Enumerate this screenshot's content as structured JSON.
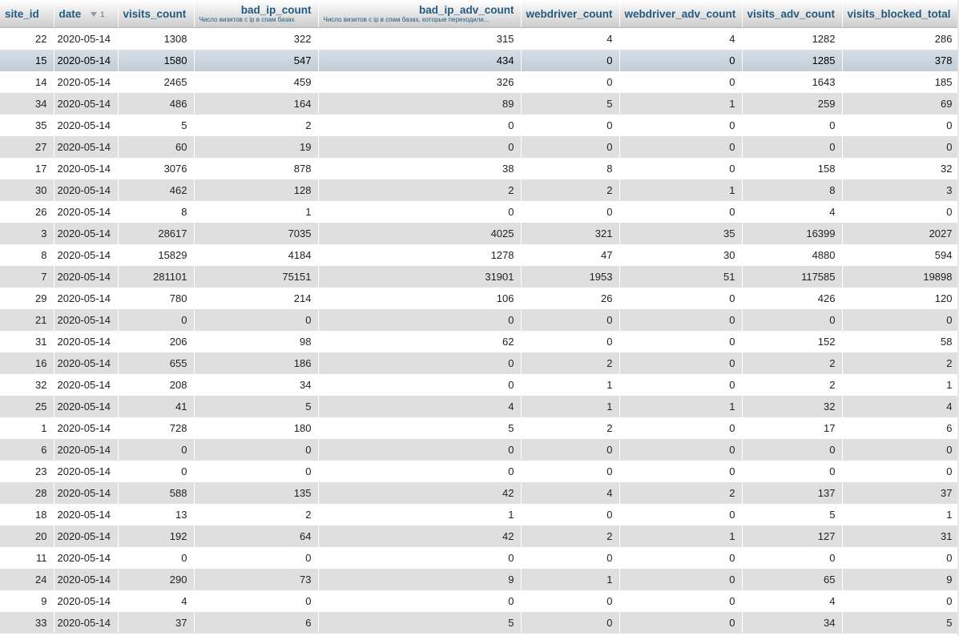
{
  "columns": [
    {
      "name": "site_id",
      "comment": ""
    },
    {
      "name": "date",
      "comment": "",
      "sort_order": "1",
      "sort_direction": "desc"
    },
    {
      "name": "visits_count",
      "comment": ""
    },
    {
      "name": "bad_ip_count",
      "comment": "Число визитов с ip в спам базах"
    },
    {
      "name": "bad_ip_adv_count",
      "comment": "Число визитов с ip в спам базах, которые переходили..."
    },
    {
      "name": "webdriver_count",
      "comment": ""
    },
    {
      "name": "webdriver_adv_count",
      "comment": ""
    },
    {
      "name": "visits_adv_count",
      "comment": ""
    },
    {
      "name": "visits_blocked_total",
      "comment": ""
    }
  ],
  "rows": [
    [
      "22",
      "2020-05-14",
      "1308",
      "322",
      "315",
      "4",
      "4",
      "1282",
      "286"
    ],
    [
      "15",
      "2020-05-14",
      "1580",
      "547",
      "434",
      "0",
      "0",
      "1285",
      "378"
    ],
    [
      "14",
      "2020-05-14",
      "2465",
      "459",
      "326",
      "0",
      "0",
      "1643",
      "185"
    ],
    [
      "34",
      "2020-05-14",
      "486",
      "164",
      "89",
      "5",
      "1",
      "259",
      "69"
    ],
    [
      "35",
      "2020-05-14",
      "5",
      "2",
      "0",
      "0",
      "0",
      "0",
      "0"
    ],
    [
      "27",
      "2020-05-14",
      "60",
      "19",
      "0",
      "0",
      "0",
      "0",
      "0"
    ],
    [
      "17",
      "2020-05-14",
      "3076",
      "878",
      "38",
      "8",
      "0",
      "158",
      "32"
    ],
    [
      "30",
      "2020-05-14",
      "462",
      "128",
      "2",
      "2",
      "1",
      "8",
      "3"
    ],
    [
      "26",
      "2020-05-14",
      "8",
      "1",
      "0",
      "0",
      "0",
      "4",
      "0"
    ],
    [
      "3",
      "2020-05-14",
      "28617",
      "7035",
      "4025",
      "321",
      "35",
      "16399",
      "2027"
    ],
    [
      "8",
      "2020-05-14",
      "15829",
      "4184",
      "1278",
      "47",
      "30",
      "4880",
      "594"
    ],
    [
      "7",
      "2020-05-14",
      "281101",
      "75151",
      "31901",
      "1953",
      "51",
      "117585",
      "19898"
    ],
    [
      "29",
      "2020-05-14",
      "780",
      "214",
      "106",
      "26",
      "0",
      "426",
      "120"
    ],
    [
      "21",
      "2020-05-14",
      "0",
      "0",
      "0",
      "0",
      "0",
      "0",
      "0"
    ],
    [
      "31",
      "2020-05-14",
      "206",
      "98",
      "62",
      "0",
      "0",
      "152",
      "58"
    ],
    [
      "16",
      "2020-05-14",
      "655",
      "186",
      "0",
      "2",
      "0",
      "2",
      "2"
    ],
    [
      "32",
      "2020-05-14",
      "208",
      "34",
      "0",
      "1",
      "0",
      "2",
      "1"
    ],
    [
      "25",
      "2020-05-14",
      "41",
      "5",
      "4",
      "1",
      "1",
      "32",
      "4"
    ],
    [
      "1",
      "2020-05-14",
      "728",
      "180",
      "5",
      "2",
      "0",
      "17",
      "6"
    ],
    [
      "6",
      "2020-05-14",
      "0",
      "0",
      "0",
      "0",
      "0",
      "0",
      "0"
    ],
    [
      "23",
      "2020-05-14",
      "0",
      "0",
      "0",
      "0",
      "0",
      "0",
      "0"
    ],
    [
      "28",
      "2020-05-14",
      "588",
      "135",
      "42",
      "4",
      "2",
      "137",
      "37"
    ],
    [
      "18",
      "2020-05-14",
      "13",
      "2",
      "1",
      "0",
      "0",
      "5",
      "1"
    ],
    [
      "20",
      "2020-05-14",
      "192",
      "64",
      "42",
      "2",
      "1",
      "127",
      "31"
    ],
    [
      "11",
      "2020-05-14",
      "0",
      "0",
      "0",
      "0",
      "0",
      "0",
      "0"
    ],
    [
      "24",
      "2020-05-14",
      "290",
      "73",
      "9",
      "1",
      "0",
      "65",
      "9"
    ],
    [
      "9",
      "2020-05-14",
      "4",
      "0",
      "0",
      "0",
      "0",
      "4",
      "0"
    ],
    [
      "33",
      "2020-05-14",
      "37",
      "6",
      "5",
      "0",
      "0",
      "34",
      "5"
    ]
  ],
  "highlighted_row": 1,
  "colors": {
    "header_text": "#235a81",
    "row_even": "#dfdfdf",
    "row_odd": "#ffffff",
    "row_highlight": "#c8d4de"
  },
  "icons": {
    "sort": "sort-desc-arrow-icon"
  }
}
